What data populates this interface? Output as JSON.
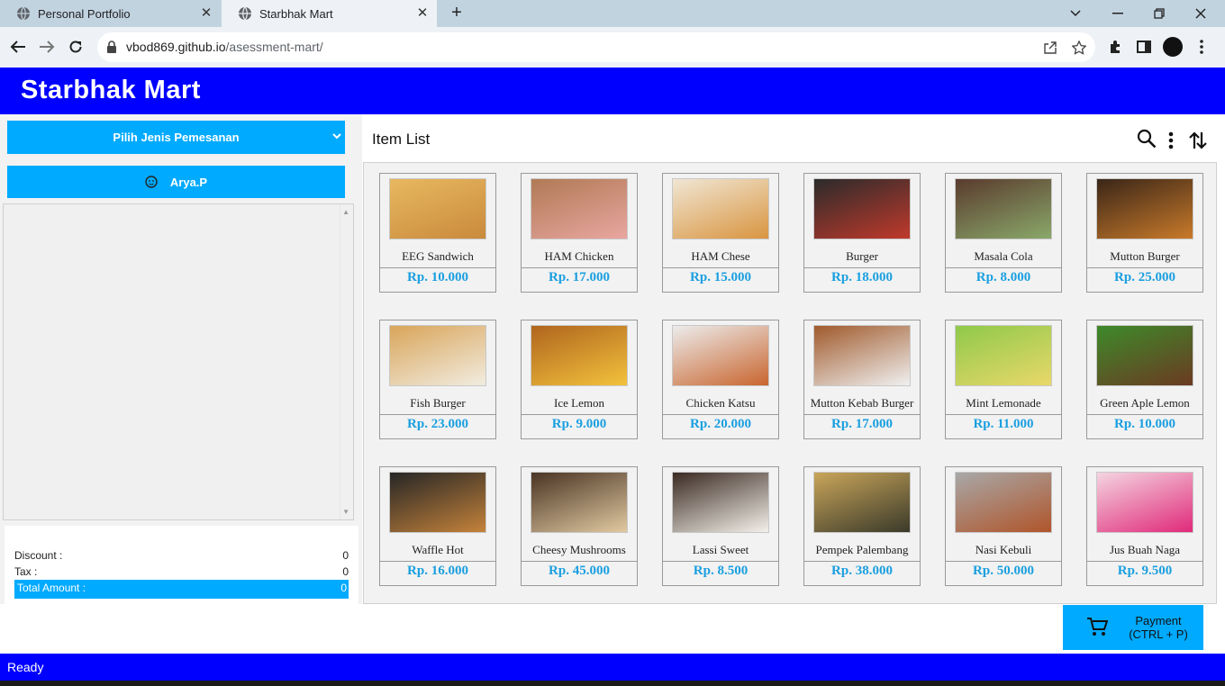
{
  "browser": {
    "tabs": [
      {
        "title": "Personal Portfolio",
        "active": false
      },
      {
        "title": "Starbhak Mart",
        "active": true
      }
    ],
    "url_host": "vbod869.github.io",
    "url_path": "/asessment-mart/"
  },
  "app": {
    "title": "Starbhak Mart",
    "order_type_label": "Pilih Jenis Pemesanan",
    "customer_name": "Arya.P",
    "summary": {
      "discount_label": "Discount :",
      "discount_value": "0",
      "tax_label": "Tax :",
      "tax_value": "0",
      "total_label": "Total Amount :",
      "total_value": "0"
    },
    "item_list_title": "Item List",
    "items": [
      {
        "name": "EEG Sandwich",
        "price": "Rp. 10.000",
        "colors": [
          "#e8b860",
          "#c98a3c"
        ]
      },
      {
        "name": "HAM Chicken",
        "price": "Rp. 17.000",
        "colors": [
          "#b07a55",
          "#e9a6a0"
        ]
      },
      {
        "name": "HAM Chese",
        "price": "Rp. 15.000",
        "colors": [
          "#f0e6d4",
          "#d99540"
        ]
      },
      {
        "name": "Burger",
        "price": "Rp. 18.000",
        "colors": [
          "#2b2b2b",
          "#c0392b"
        ]
      },
      {
        "name": "Masala Cola",
        "price": "Rp. 8.000",
        "colors": [
          "#5a3b2e",
          "#8aa86a"
        ]
      },
      {
        "name": "Mutton Burger",
        "price": "Rp. 25.000",
        "colors": [
          "#3a2618",
          "#c97a2a"
        ]
      },
      {
        "name": "Fish Burger",
        "price": "Rp. 23.000",
        "colors": [
          "#d9a55a",
          "#f1ece0"
        ]
      },
      {
        "name": "Ice Lemon",
        "price": "Rp. 9.000",
        "colors": [
          "#b0651e",
          "#f2c23c"
        ]
      },
      {
        "name": "Chicken Katsu",
        "price": "Rp. 20.000",
        "colors": [
          "#ececec",
          "#c9652e"
        ]
      },
      {
        "name": "Mutton Kebab Burger",
        "price": "Rp. 17.000",
        "colors": [
          "#a05a2c",
          "#f0f0f0"
        ]
      },
      {
        "name": "Mint Lemonade",
        "price": "Rp. 11.000",
        "colors": [
          "#8fc94a",
          "#e9d86a"
        ]
      },
      {
        "name": "Green Aple Lemon",
        "price": "Rp. 10.000",
        "colors": [
          "#3d8a2a",
          "#6b3a22"
        ]
      },
      {
        "name": "Waffle Hot",
        "price": "Rp. 16.000",
        "colors": [
          "#262626",
          "#c4823a"
        ]
      },
      {
        "name": "Cheesy Mushrooms",
        "price": "Rp. 45.000",
        "colors": [
          "#4a3424",
          "#e0c9a0"
        ]
      },
      {
        "name": "Lassi Sweet",
        "price": "Rp. 8.500",
        "colors": [
          "#3a2a22",
          "#f4f1ea"
        ]
      },
      {
        "name": "Pempek Palembang",
        "price": "Rp. 38.000",
        "colors": [
          "#c9a55a",
          "#3a3a2a"
        ]
      },
      {
        "name": "Nasi Kebuli",
        "price": "Rp. 50.000",
        "colors": [
          "#a8a8a8",
          "#b0552a"
        ]
      },
      {
        "name": "Jus Buah Naga",
        "price": "Rp. 9.500",
        "colors": [
          "#f4d4e0",
          "#e02a7a"
        ]
      }
    ],
    "payment_line1": "Payment",
    "payment_line2": "(CTRL + P)",
    "status": "Ready"
  }
}
